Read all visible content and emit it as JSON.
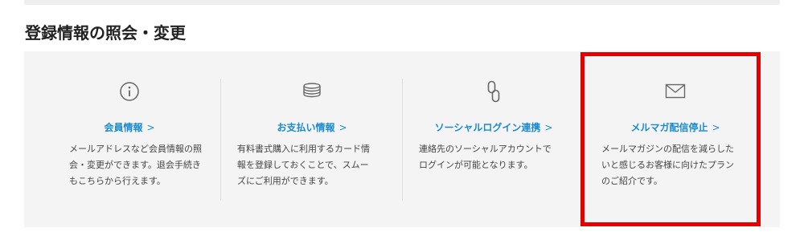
{
  "section": {
    "title": "登録情報の照会・変更"
  },
  "cards": [
    {
      "icon": "info-icon",
      "title": "会員情報",
      "chevron": ">",
      "desc_lines": [
        "メールアドレスなど会員情報の照",
        "会・変更ができます。退会手続き",
        "もこちらから行えます。"
      ]
    },
    {
      "icon": "coins-stack-icon",
      "title": "お支払い情報",
      "chevron": ">",
      "desc_lines": [
        "有料書式購入に利用するカード情",
        "報を登録しておくことで、スムー",
        "ズにご利用ができます。"
      ]
    },
    {
      "icon": "link-icon",
      "title": "ソーシャルログイン連携",
      "chevron": ">",
      "desc_lines": [
        "連絡先のソーシャルアカウントで",
        "ログインが可能となります。"
      ]
    },
    {
      "icon": "envelope-icon",
      "title": "メルマガ配信停止",
      "chevron": ">",
      "desc_lines": [
        "メールマガジンの配信を減らした",
        "いと感じるお客様に向けたプラン",
        "のご紹介です。"
      ]
    }
  ],
  "colors": {
    "link": "#1a8ad0",
    "highlight": "#e50000",
    "panel": "#f4f4f4"
  }
}
